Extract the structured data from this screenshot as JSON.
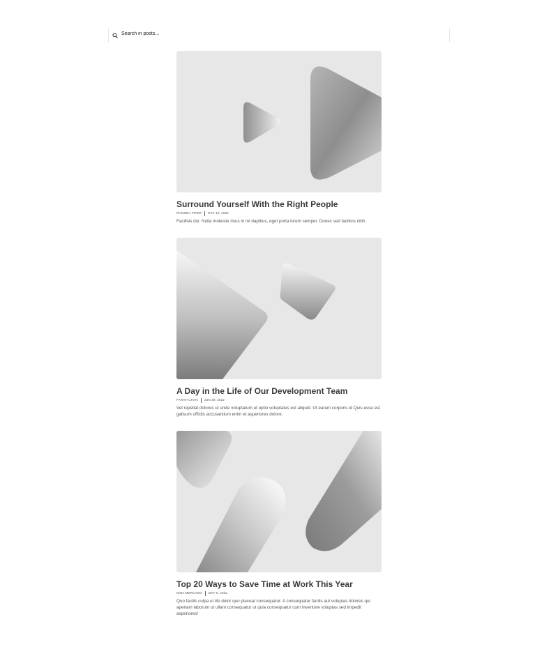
{
  "search": {
    "placeholder": "Search in posts...",
    "icon": "search-icon"
  },
  "posts": [
    {
      "title": "Surround Yourself With the Right People",
      "author": "RHONDA PIPER",
      "date": "OCT 10, 2022",
      "excerpt": "Facilisis dui. Nulla molestie risus in mi dapibus, eget porta lorem semper. Donec sed facilisis nibh."
    },
    {
      "title": "A Day in the Life of Our Development Team",
      "author": "FARAH CHAN",
      "date": "JUN 29, 2022",
      "excerpt": "Vel repellat dolores ut unde voluptatum ut optio voluptates est aliquid. Ut earum corporis id Quis esse est galisum officiis accusantium enim et asperiores dolore."
    },
    {
      "title": "Top 20 Ways to Save Time at Work This Year",
      "author": "NINA MERCADO",
      "date": "MAY 5, 2022",
      "excerpt": "Quo facilis culpa ut illo dolor quo placeat consequatur. A consequatur facilis aut voluptas dolores qui aperiam laborum ut ullam consequatur ut quia consequatur cum inventore voluptas sed impedit asperiores!"
    }
  ],
  "colors": {
    "image_bg": "#e7e7e8",
    "title": "#3a3a3a",
    "text": "#555555"
  }
}
